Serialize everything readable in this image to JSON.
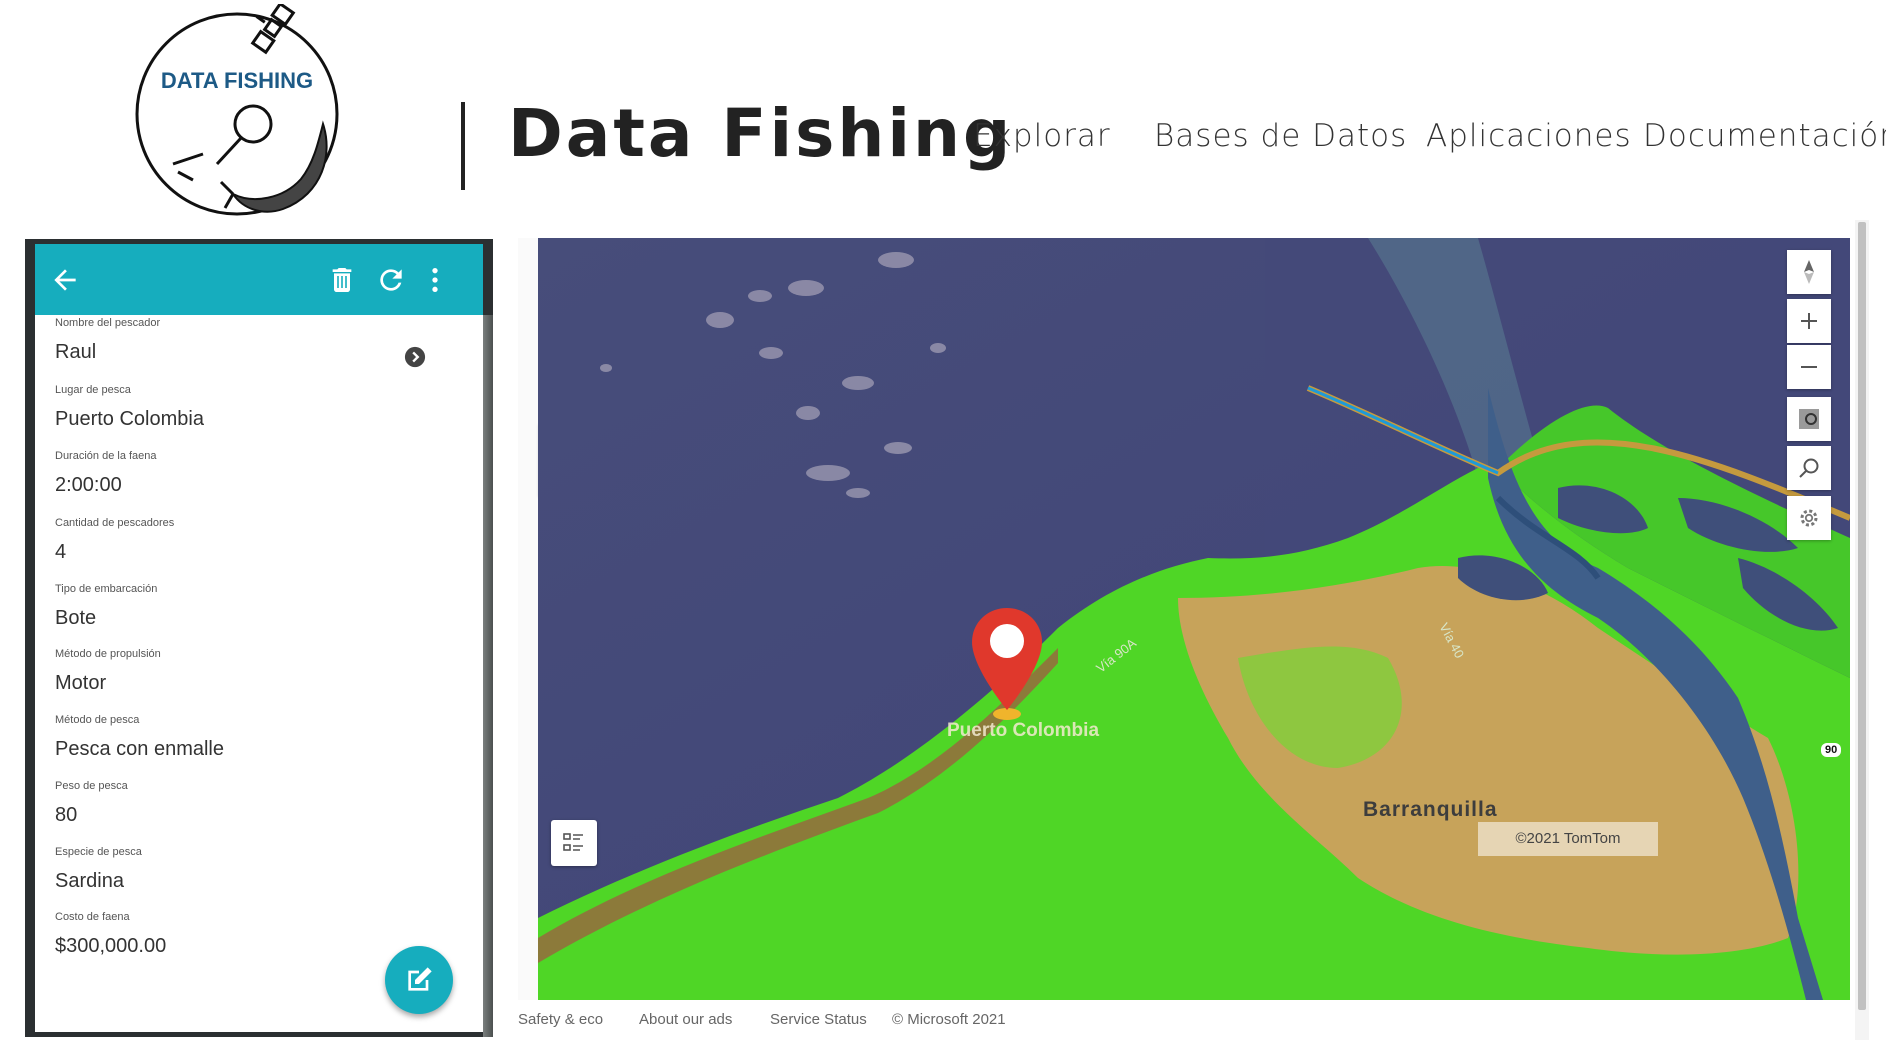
{
  "header": {
    "logo_text": "DATA FISHING",
    "site_title": "Data Fishing",
    "nav": [
      "Explorar",
      "Bases de Datos",
      "Aplicaciones",
      "Documentación"
    ]
  },
  "app": {
    "fields": [
      {
        "label": "Nombre del pescador",
        "value": "Raul"
      },
      {
        "label": "Lugar de pesca",
        "value": "Puerto Colombia"
      },
      {
        "label": "Duración de la faena",
        "value": "2:00:00"
      },
      {
        "label": "Cantidad de pescadores",
        "value": "4"
      },
      {
        "label": "Tipo de embarcación",
        "value": "Bote"
      },
      {
        "label": "Método de propulsión",
        "value": "Motor"
      },
      {
        "label": "Método de pesca",
        "value": "Pesca con enmalle"
      },
      {
        "label": "Peso de pesca",
        "value": "80"
      },
      {
        "label": "Especie de pesca",
        "value": "Sardina"
      },
      {
        "label": "Costo de faena",
        "value": "$300,000.00"
      }
    ],
    "accent_color": "#16adbe",
    "icons": [
      "back-arrow-icon",
      "trash-icon",
      "refresh-icon",
      "more-vert-icon",
      "chevron-right-circle-icon",
      "edit-icon"
    ]
  },
  "map": {
    "labels": {
      "marker_place": "Puerto Colombia",
      "city": "Barranquilla",
      "road_1": "Vía 90A",
      "road_2": "Vía 40",
      "shield": "90"
    },
    "copyright": "©2021 TomTom",
    "footer_links": [
      "Safety & eco",
      "About our ads",
      "Service Status",
      "© Microsoft 2021"
    ],
    "marker_color": "#e0382c"
  }
}
